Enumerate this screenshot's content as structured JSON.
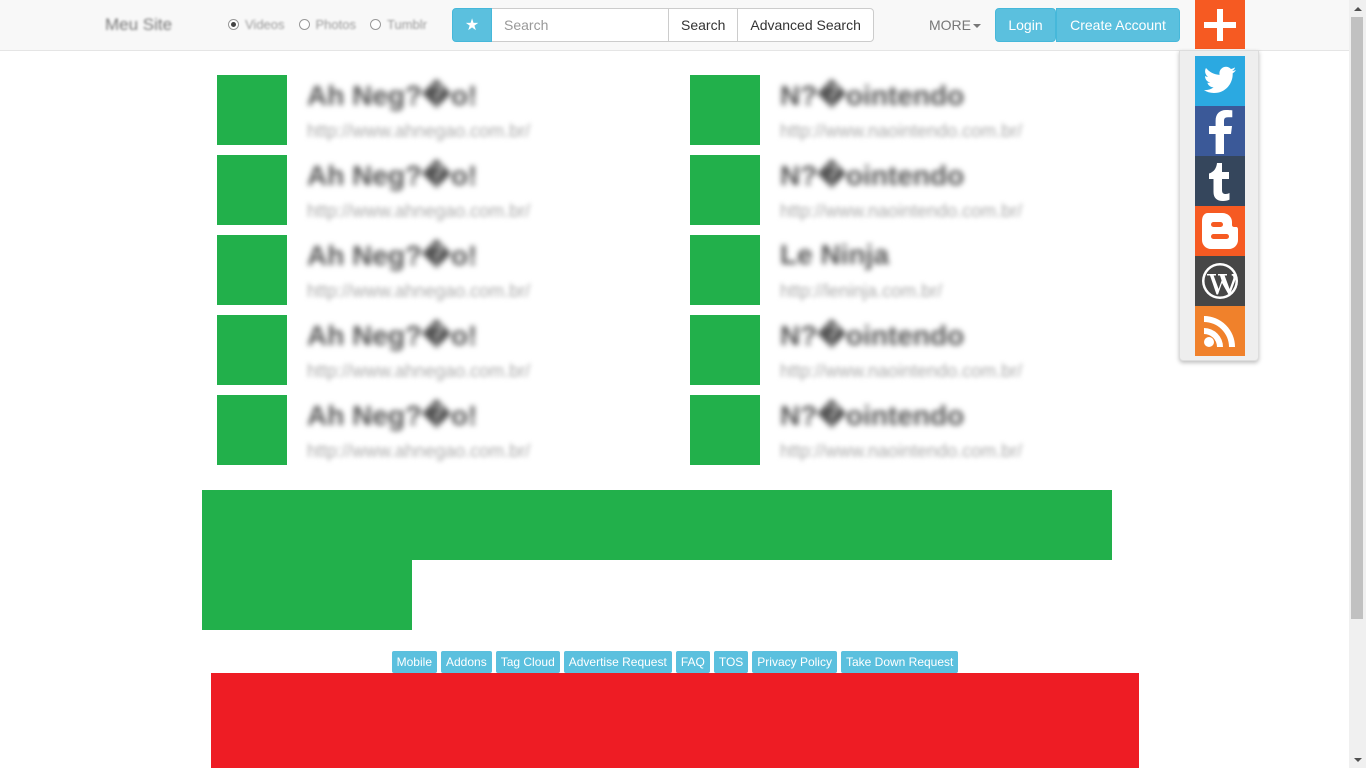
{
  "navbar": {
    "brand": "Meu Site",
    "radios": [
      {
        "label": "Videos",
        "checked": true
      },
      {
        "label": "Photos",
        "checked": false
      },
      {
        "label": "Tumblr",
        "checked": false
      }
    ],
    "star_icon": "star-icon",
    "search_placeholder": "Search",
    "search_button": "Search",
    "advanced_search_button": "Advanced Search",
    "more_label": "MORE",
    "login_button": "Login",
    "create_account_button": "Create Account"
  },
  "share": {
    "plus_icon": "plus-icon",
    "items": [
      {
        "name": "twitter",
        "color": "#2ba9e1"
      },
      {
        "name": "facebook",
        "color": "#3b5998"
      },
      {
        "name": "tumblr",
        "color": "#35465c"
      },
      {
        "name": "blogger",
        "color": "#f65a22"
      },
      {
        "name": "wordpress",
        "color": "#464646"
      },
      {
        "name": "rss",
        "color": "#f0812b"
      }
    ]
  },
  "left_column": [
    {
      "title": "Ah Neg?�o!",
      "url": "http://www.ahnegao.com.br/"
    },
    {
      "title": "Ah Neg?�o!",
      "url": "http://www.ahnegao.com.br/"
    },
    {
      "title": "Ah Neg?�o!",
      "url": "http://www.ahnegao.com.br/"
    },
    {
      "title": "Ah Neg?�o!",
      "url": "http://www.ahnegao.com.br/"
    },
    {
      "title": "Ah Neg?�o!",
      "url": "http://www.ahnegao.com.br/"
    }
  ],
  "right_column": [
    {
      "title": "N?�ointendo",
      "url": "http://www.naointendo.com.br/"
    },
    {
      "title": "N?�ointendo",
      "url": "http://www.naointendo.com.br/"
    },
    {
      "title": "Le Ninja",
      "url": "http://leninja.com.br/"
    },
    {
      "title": "N?�ointendo",
      "url": "http://www.naointendo.com.br/"
    },
    {
      "title": "N?�ointendo",
      "url": "http://www.naointendo.com.br/"
    }
  ],
  "footer_links": [
    "Mobile",
    "Addons",
    "Tag Cloud",
    "Advertise Request",
    "FAQ",
    "TOS",
    "Privacy Policy",
    "Take Down Request"
  ],
  "colors": {
    "accent": "#5bc0de",
    "thumb": "#22b04b",
    "ad_red": "#ee1c24",
    "share_orange": "#f65a22"
  }
}
